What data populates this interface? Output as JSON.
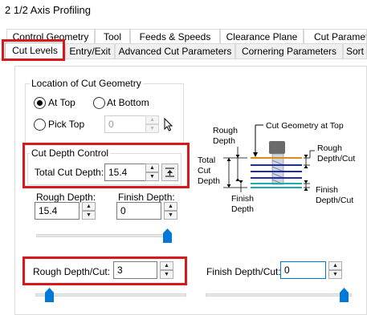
{
  "window": {
    "title": "2 1/2 Axis Profiling"
  },
  "tabs_row1": [
    {
      "label": "Control Geometry"
    },
    {
      "label": "Tool"
    },
    {
      "label": "Feeds & Speeds"
    },
    {
      "label": "Clearance Plane"
    },
    {
      "label": "Cut Paramete"
    }
  ],
  "tabs_row2": [
    {
      "label": "Cut Levels",
      "selected": true
    },
    {
      "label": "Entry/Exit"
    },
    {
      "label": "Advanced Cut Parameters"
    },
    {
      "label": "Cornering Parameters"
    },
    {
      "label": "Sort"
    }
  ],
  "location": {
    "legend": "Location of Cut Geometry",
    "at_top": {
      "label": "At Top",
      "selected": true
    },
    "at_bottom": {
      "label": "At Bottom",
      "selected": false
    },
    "pick_top": {
      "label": "Pick Top",
      "selected": false,
      "value": "0"
    }
  },
  "cut_depth_control": {
    "legend": "Cut Depth Control",
    "total_label": "Total Cut Depth:",
    "total_value": "15.4"
  },
  "rough_depth": {
    "label": "Rough Depth:",
    "value": "15.4"
  },
  "finish_depth": {
    "label": "Finish Depth:",
    "value": "0"
  },
  "depth_slider": {
    "level": 1.0
  },
  "rough_depth_cut": {
    "label": "Rough Depth/Cut:",
    "value": "3",
    "slider_level": 0.0
  },
  "finish_depth_cut": {
    "label": "Finish Depth/Cut:",
    "value": "0",
    "slider_level": 1.0
  },
  "diagram": {
    "rough_depth": [
      "Rough",
      "Depth"
    ],
    "cut_geometry_at_top": "Cut Geometry at Top",
    "total_cut_depth": [
      "Total",
      "Cut",
      "Depth"
    ],
    "finish_depth": [
      "Finish",
      "Depth"
    ],
    "rough_depth_cut": [
      "Rough",
      "Depth/Cut"
    ],
    "finish_depth_cut": [
      "Finish",
      "Depth/Cut"
    ]
  },
  "colors": {
    "highlight": "#d7191c",
    "slider_thumb": "#0078d7",
    "orange_line": "#e08a1e",
    "blue_line": "#1f2aa8"
  }
}
